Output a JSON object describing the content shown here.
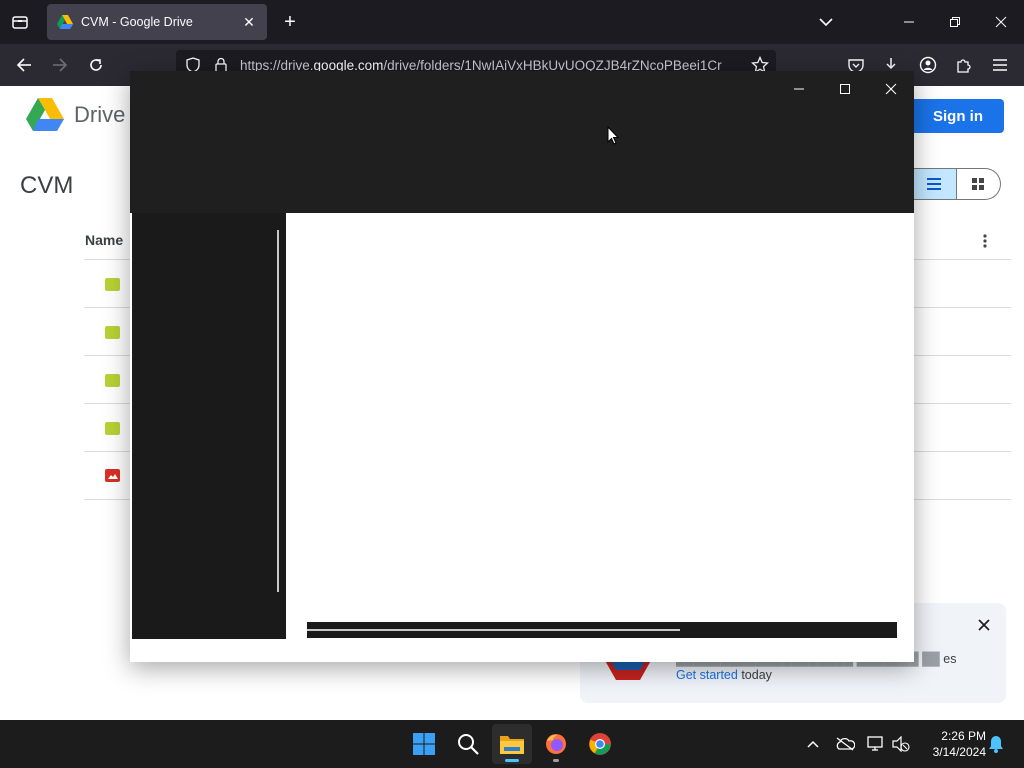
{
  "browser": {
    "tab_title": "CVM - Google Drive",
    "url_prefix": "https://drive.",
    "url_domain": "google.com",
    "url_path": "/drive/folders/1NwIAiVxHBkUvUOQZJB4rZNcoPBeei1Cr"
  },
  "drive": {
    "product_name": "Drive",
    "sign_in_label": "Sign in",
    "folder_title": "CVM",
    "column_name": "Name",
    "files": [
      {
        "type": "sheet"
      },
      {
        "type": "sheet"
      },
      {
        "type": "sheet"
      },
      {
        "type": "sheet"
      },
      {
        "type": "image"
      }
    ],
    "promo": {
      "line1_visible": "es",
      "link_text": "Get started",
      "line2_suffix": " today"
    }
  },
  "taskbar": {
    "time": "2:26 PM",
    "date": "3/14/2024",
    "apps": [
      "start-menu",
      "search",
      "file-explorer",
      "firefox",
      "chrome"
    ]
  },
  "colors": {
    "accent": "#1a73e8",
    "window_dark": "#1f1f1f",
    "taskbar": "#1c1c1c"
  }
}
